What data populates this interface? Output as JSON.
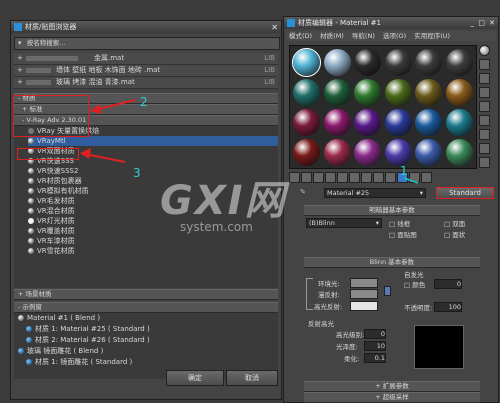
{
  "browser": {
    "title": "材质/贴图浏览器",
    "search_placeholder": "按名称搜索...",
    "lib_rows": [
      {
        "name": "金属.mat",
        "tag": "LIB"
      },
      {
        "name": "墙体 壁纸 地板 木饰面 地砖 .mat",
        "tag": "LIB"
      },
      {
        "name": "玻璃 烤漆 混油 青漆.mat",
        "tag": "LIB"
      }
    ],
    "materials_header": "- 材质",
    "standard": "+ 标准",
    "vray_group": "- V-Ray Adv 2.30.01",
    "vray_items": [
      "VRay 矢量置换烘焙",
      "VRayMtl",
      "VR双面材质",
      "VR快速SSS",
      "VR快速SSS2",
      "VR材质包裹器",
      "VR模拟有机材质",
      "VR毛发材质",
      "VR混合材质",
      "VR灯光材质",
      "VR覆盖材质",
      "VR车漆材质",
      "VR雪花材质"
    ],
    "scene_materials": "+ 场景材质",
    "sample_slots": "- 示例窗",
    "slot_items": [
      "Material #1 ( Blend )",
      "材质 1: Material #25 ( Standard )",
      "材质 2: Material #26 ( Standard )",
      "玻璃 镜面雕花 ( Blend )",
      "材质 1: 镜面雕花 ( Standard )"
    ],
    "ok_label": "确定",
    "cancel_label": "取消"
  },
  "editor": {
    "title": "材质编辑器 - Material #1",
    "menu": [
      "模式(D)",
      "材质(M)",
      "导航(N)",
      "选项(O)",
      "实用程序(U)"
    ],
    "swatch_colors": [
      "#4fb3d4",
      "#8ea9c4",
      "#2a2a2a",
      "#3a3a3a",
      "#3c3c3c",
      "#3d3d3d",
      "#1f6f6a",
      "#1f5f3a",
      "#2d7a2d",
      "#4a6a1a",
      "#6a5a1a",
      "#8a5a1a",
      "#7a1a3a",
      "#8a1a6a",
      "#5a1a8a",
      "#2a3a9a",
      "#1a5a9a",
      "#1a7a8a",
      "#7a1a1a",
      "#9a2a4a",
      "#8a2a8a",
      "#4a3aaa",
      "#3a5aaa",
      "#3a8a5a"
    ],
    "material_name": "Material #25",
    "type_button": "Standard",
    "shader_rollout": "明暗器基本参数",
    "shader_value": "(B)Blinn",
    "wire": "线框",
    "two_sided": "双面",
    "face_map": "面贴图",
    "faceted": "面状",
    "blinn_rollout": "Blinn 基本参数",
    "self_illum": "自发光",
    "color": "颜色",
    "self_illum_value": "0",
    "ambient": "环境光:",
    "diffuse": "漫反射:",
    "specular": "高光反射:",
    "opacity": "不透明度:",
    "opacity_value": "100",
    "spec_highlights": "反射高光",
    "spec_level": "高光级别:",
    "spec_level_value": "0",
    "glossiness": "光泽度:",
    "glossiness_value": "10",
    "soften": "柔化:",
    "soften_value": "0.1",
    "extended": "扩展参数",
    "supersampling": "超级采样"
  },
  "annotations": {
    "n1": "1",
    "n2": "2",
    "n3": "3"
  },
  "watermark": {
    "main": "GXI网",
    "sub": "system.com"
  }
}
